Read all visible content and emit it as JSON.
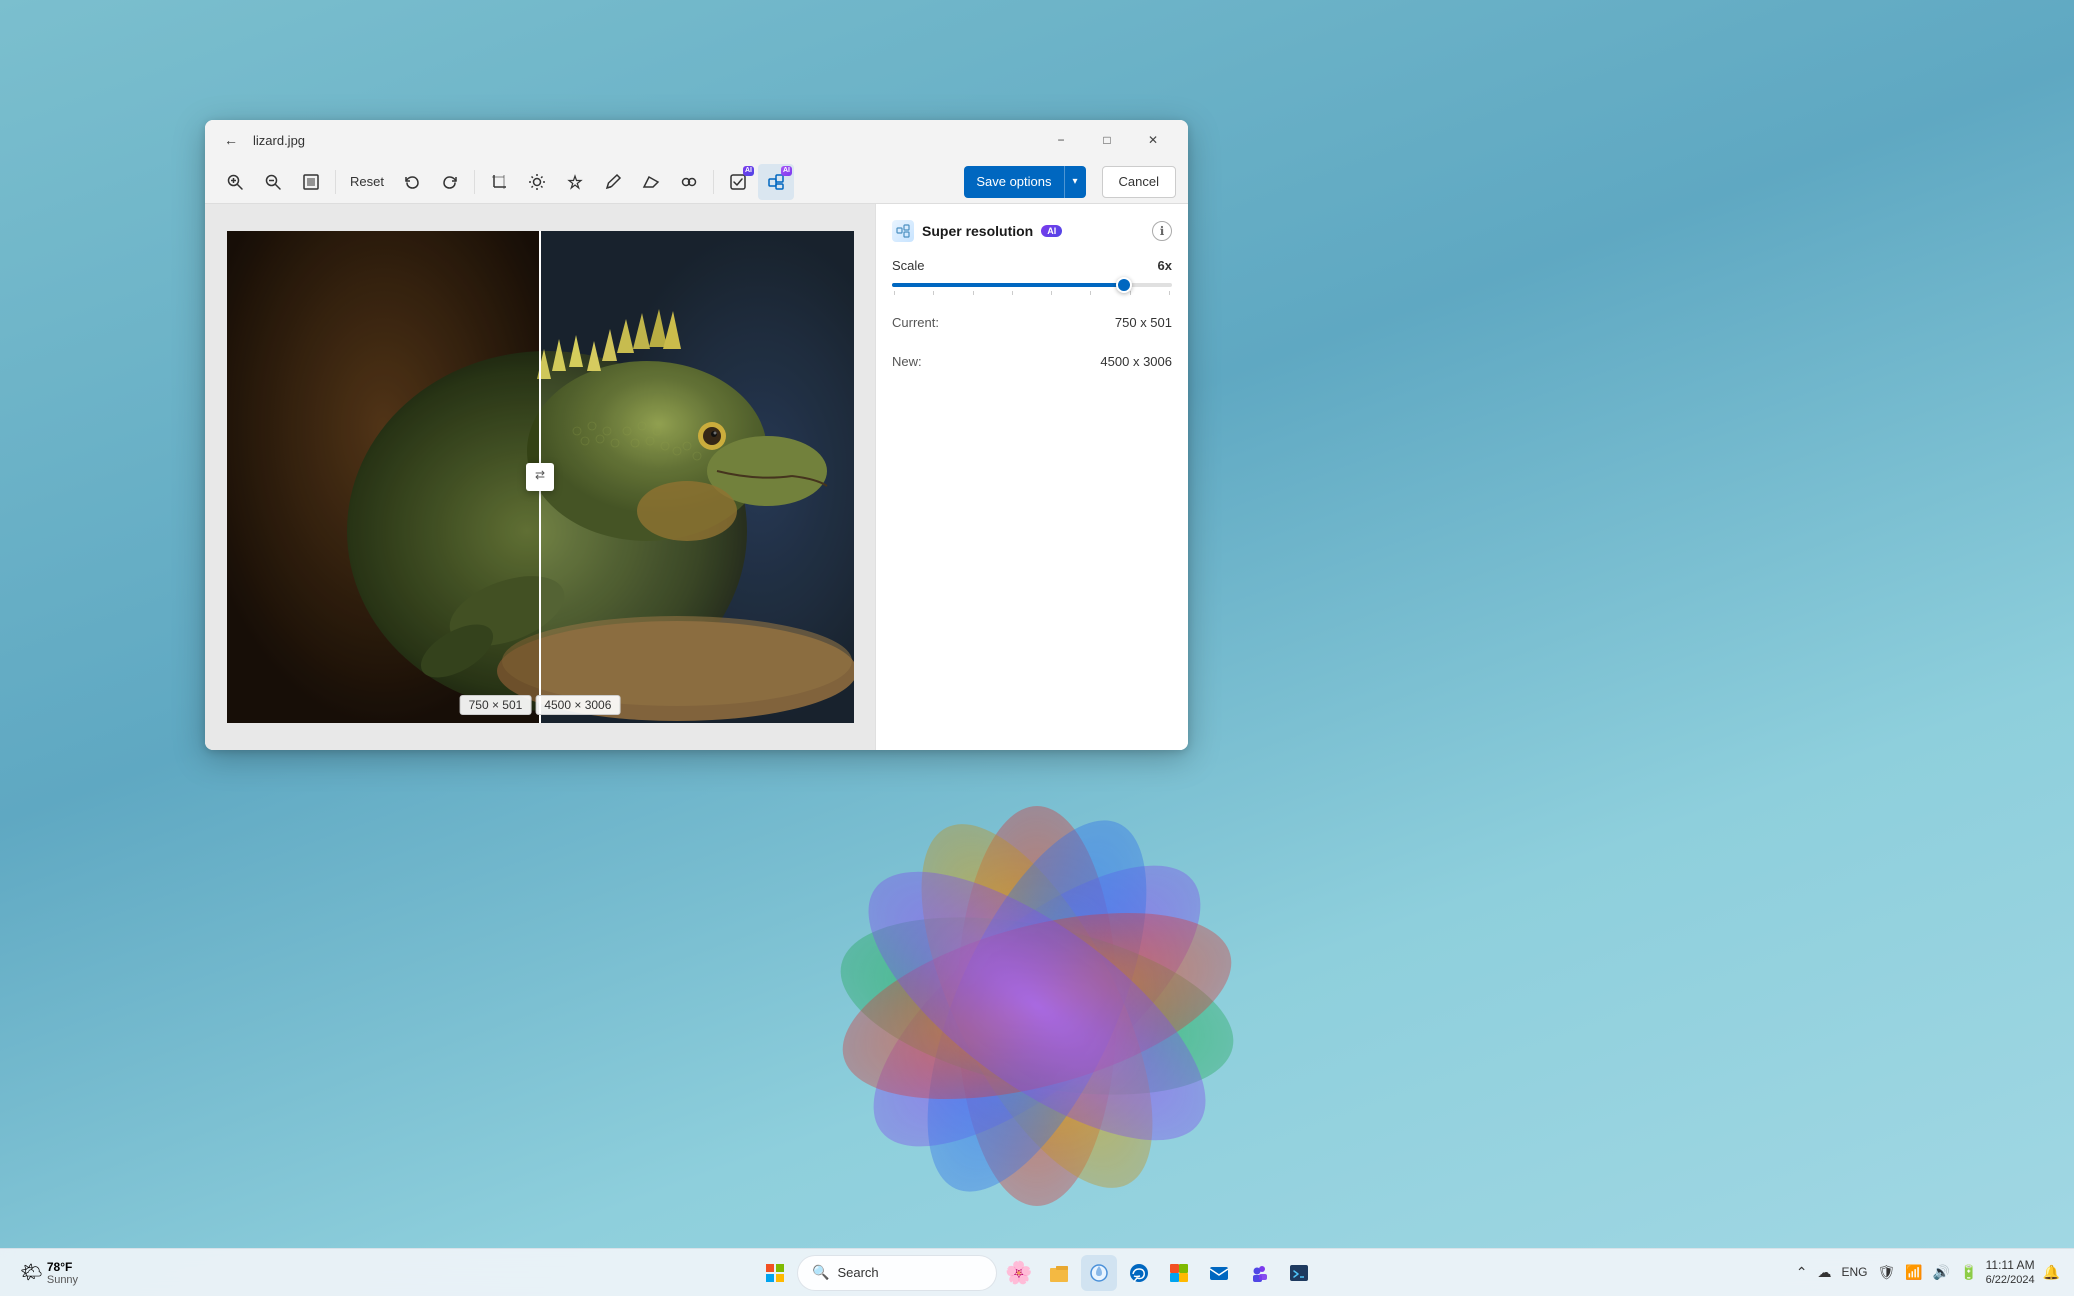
{
  "desktop": {
    "background_color": "#6aa8c4"
  },
  "window": {
    "title": "lizard.jpg",
    "filename": "lizard.jpg"
  },
  "toolbar": {
    "reset_label": "Reset",
    "save_options_label": "Save options",
    "cancel_label": "Cancel",
    "tools": [
      {
        "name": "zoom-in",
        "icon": "🔍",
        "label": "Zoom in"
      },
      {
        "name": "zoom-out",
        "icon": "🔍",
        "label": "Zoom out"
      },
      {
        "name": "fit-view",
        "icon": "⊡",
        "label": "Fit to view"
      },
      {
        "name": "reset",
        "label": "Reset"
      },
      {
        "name": "undo",
        "icon": "↩",
        "label": "Undo"
      },
      {
        "name": "redo",
        "icon": "↪",
        "label": "Redo"
      },
      {
        "name": "crop",
        "icon": "⊞",
        "label": "Crop",
        "ai": false
      },
      {
        "name": "brightness",
        "icon": "☀",
        "label": "Brightness",
        "ai": false
      },
      {
        "name": "retouch",
        "icon": "⌂",
        "label": "Retouch",
        "ai": false
      },
      {
        "name": "draw",
        "icon": "✏",
        "label": "Draw",
        "ai": false
      },
      {
        "name": "erase",
        "icon": "◇",
        "label": "Erase",
        "ai": false
      },
      {
        "name": "effects",
        "icon": "✦",
        "label": "Effects",
        "ai": false
      },
      {
        "name": "background-remove",
        "icon": "⊠",
        "label": "Remove background",
        "ai": true
      },
      {
        "name": "super-resolution",
        "icon": "⊞",
        "label": "Super resolution",
        "ai": true,
        "active": true
      }
    ]
  },
  "panel": {
    "title": "Super resolution",
    "ai_badge": "AI",
    "scale_label": "Scale",
    "scale_value": "6x",
    "scale_percent": 83,
    "current_label": "Current:",
    "current_value": "750 x 501",
    "new_label": "New:",
    "new_value": "4500 x 3006",
    "info_icon": "ℹ"
  },
  "canvas": {
    "original_res": "750 × 501",
    "new_res": "4500 × 3006"
  },
  "taskbar": {
    "weather_temp": "78°F",
    "weather_condition": "Sunny",
    "search_placeholder": "Search",
    "time": "11:11 AM",
    "date": "6/22/2024",
    "apps": [
      {
        "name": "start",
        "label": "Start"
      },
      {
        "name": "search",
        "label": "Search"
      },
      {
        "name": "flower",
        "label": "Bloom"
      },
      {
        "name": "file-explorer",
        "label": "File Explorer"
      },
      {
        "name": "browser-edge",
        "label": "Microsoft Edge"
      },
      {
        "name": "edge-colored",
        "label": "Edge colored"
      },
      {
        "name": "apps-store",
        "label": "Microsoft Store"
      },
      {
        "name": "mail",
        "label": "Mail"
      },
      {
        "name": "teams",
        "label": "Teams"
      },
      {
        "name": "dev-tool",
        "label": "Dev"
      }
    ]
  }
}
